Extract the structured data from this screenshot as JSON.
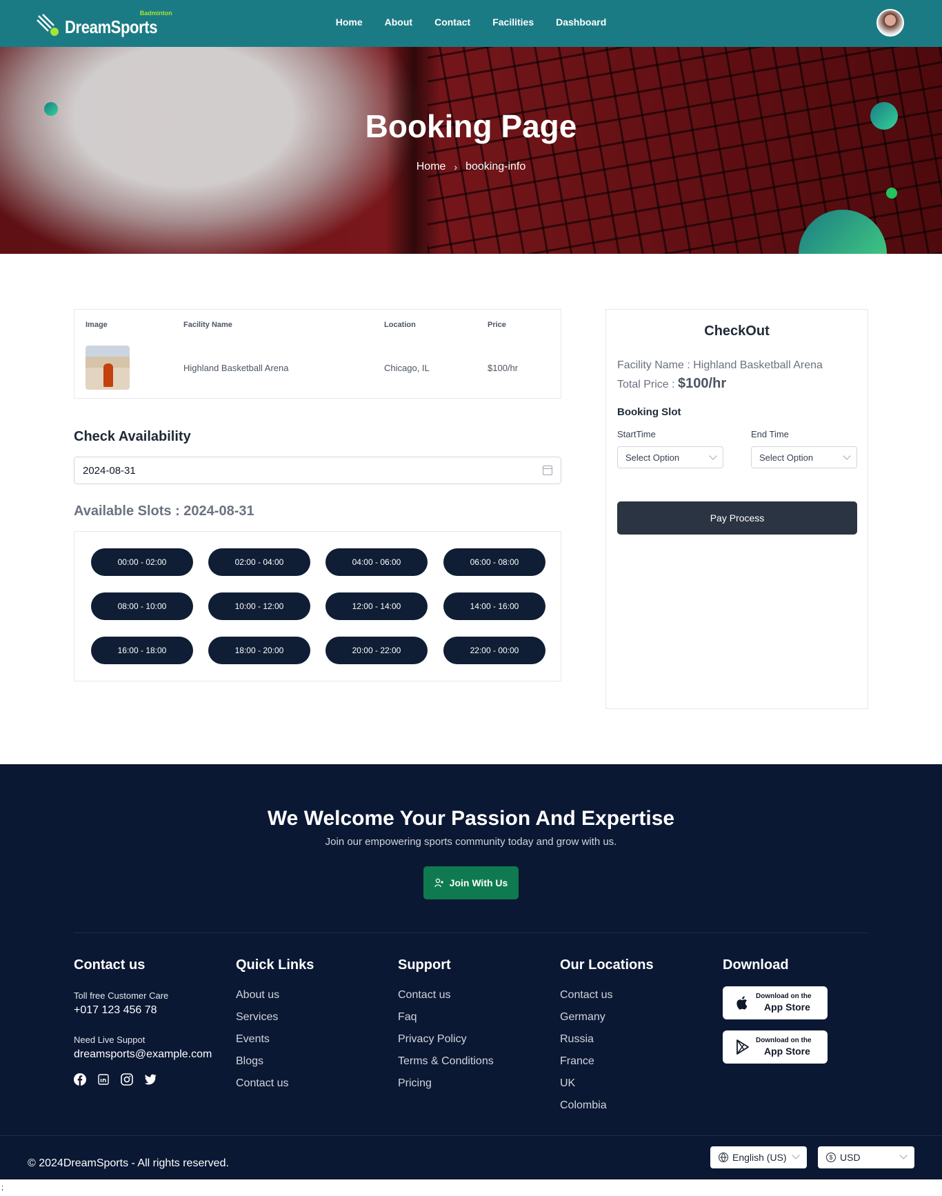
{
  "header": {
    "logo_small": "Badminton",
    "logo_main": "DreamSports",
    "nav": [
      "Home",
      "About",
      "Contact",
      "Facilities",
      "Dashboard"
    ]
  },
  "hero": {
    "title": "Booking Page",
    "breadcrumb": [
      "Home",
      "booking-info"
    ]
  },
  "facility_table": {
    "headers": [
      "Image",
      "Facility Name",
      "Location",
      "Price"
    ],
    "row": {
      "name": "Highland Basketball Arena",
      "location": "Chicago, IL",
      "price": "$100/hr"
    }
  },
  "availability": {
    "title": "Check Availability",
    "date_value": "2024-08-31",
    "slots_title": "Available Slots : 2024-08-31",
    "slots": [
      "00:00 - 02:00",
      "02:00 - 04:00",
      "04:00 - 06:00",
      "06:00 - 08:00",
      "08:00 - 10:00",
      "10:00 - 12:00",
      "12:00 - 14:00",
      "14:00 - 16:00",
      "16:00 - 18:00",
      "18:00 - 20:00",
      "20:00 - 22:00",
      "22:00 - 00:00"
    ]
  },
  "checkout": {
    "title": "CheckOut",
    "facility_label": "Facility Name : Highland Basketball Arena",
    "total_label": "Total Price :",
    "total_value": "$100/hr",
    "slot_label": "Booking Slot",
    "start_label": "StartTime",
    "end_label": "End Time",
    "start_value": "Select Option",
    "end_value": "Select Option",
    "pay_label": "Pay Process"
  },
  "footer": {
    "heading": "We Welcome Your Passion And Expertise",
    "subheading": "Join our empowering sports community today and grow with us.",
    "join_label": "Join With Us",
    "contact": {
      "title": "Contact us",
      "care_label": "Toll free Customer Care",
      "phone": "+017 123 456 78",
      "support_label": "Need Live Suppot",
      "email": "dreamsports@example.com",
      "social_icons": [
        "facebook-icon",
        "linkedin-icon",
        "instagram-icon",
        "twitter-icon"
      ]
    },
    "quick_links": {
      "title": "Quick Links",
      "items": [
        "About us",
        "Services",
        "Events",
        "Blogs",
        "Contact us"
      ]
    },
    "support": {
      "title": "Support",
      "items": [
        "Contact us",
        "Faq",
        "Privacy Policy",
        "Terms & Conditions",
        "Pricing"
      ]
    },
    "locations": {
      "title": "Our Locations",
      "items": [
        "Contact us",
        "Germany",
        "Russia",
        "France",
        "UK",
        "Colombia"
      ]
    },
    "download": {
      "title": "Download",
      "apps": [
        {
          "small": "Download on the",
          "big": "App Store",
          "icon": "apple-icon"
        },
        {
          "small": "Download on the",
          "big": "App Store",
          "icon": "google-play-icon"
        }
      ]
    },
    "copyright": "© 2024DreamSports - All rights reserved.",
    "language": "English (US)",
    "currency": "USD"
  },
  "stray_text": ";",
  "colors": {
    "header": "#1b7b84",
    "footer": "#0b1834",
    "slot": "#0f1e35",
    "join": "#0f7a4f"
  }
}
